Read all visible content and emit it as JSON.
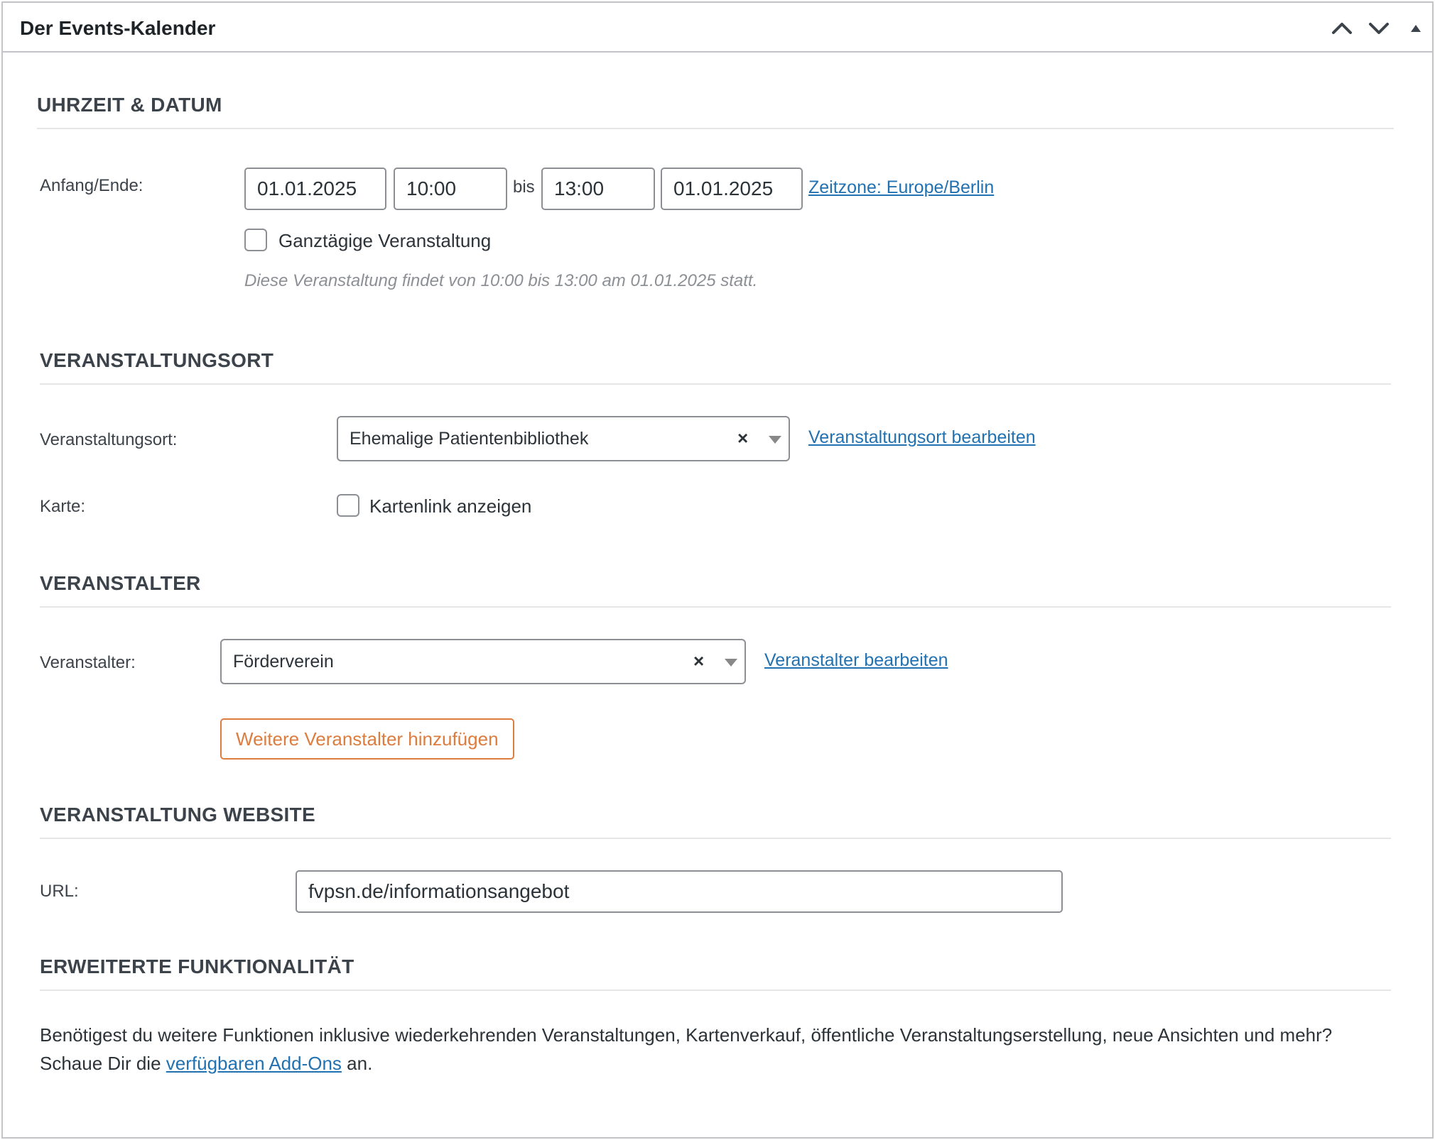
{
  "header": {
    "title": "Der Events-Kalender"
  },
  "datetime": {
    "section_title": "UHRZEIT & DATUM",
    "label": "Anfang/Ende:",
    "start_date": "01.01.2025",
    "start_time": "10:00",
    "separator": "bis",
    "end_time": "13:00",
    "end_date": "01.01.2025",
    "timezone_link": "Zeitzone: Europe/Berlin",
    "all_day_label": "Ganztägige Veranstaltung",
    "all_day_checked": false,
    "summary": "Diese Veranstaltung findet von 10:00 bis 13:00 am 01.01.2025 statt."
  },
  "venue": {
    "section_title": "VERANSTALTUNGSORT",
    "label": "Veranstaltungsort:",
    "selected": "Ehemalige Patientenbibliothek",
    "clear": "×",
    "edit_link": "Veranstaltungsort bearbeiten",
    "map_label": "Karte:",
    "map_checkbox_label": "Kartenlink anzeigen",
    "map_checked": false
  },
  "organizer": {
    "section_title": "VERANSTALTER",
    "label": "Veranstalter:",
    "selected": "Förderverein",
    "clear": "×",
    "edit_link": "Veranstalter bearbeiten",
    "add_button": "Weitere Veranstalter hinzufügen"
  },
  "website": {
    "section_title": "VERANSTALTUNG WEBSITE",
    "label": "URL:",
    "url_value": "fvpsn.de/informationsangebot"
  },
  "extended": {
    "section_title": "ERWEITERTE FUNKTIONALITÄT",
    "text_before": "Benötigest du weitere Funktionen inklusive wiederkehrenden Veranstaltungen, Kartenverkauf, öffentliche Veranstaltungserstellung, neue Ansichten und mehr? Schaue Dir die ",
    "link_text": "verfügbaren Add-Ons",
    "text_after": " an."
  },
  "colors": {
    "link": "#2271b1",
    "accent_button": "#dd7c3f",
    "border": "#8c8f94"
  },
  "icons": [
    "chevron-up-icon",
    "chevron-down-icon",
    "toggle-arrow-icon"
  ]
}
